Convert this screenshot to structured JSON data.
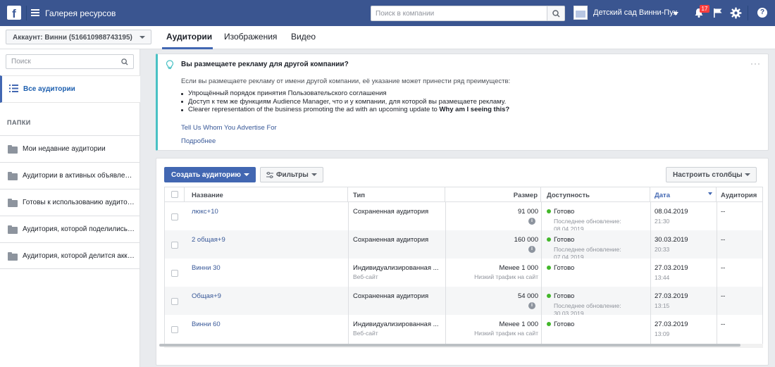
{
  "topbar": {
    "logo": "f",
    "menu_icon": "hamburger-icon",
    "title": "Галерея ресурсов",
    "search_placeholder": "Поиск в компании",
    "business_name": "Детский сад Винни-Пух",
    "notifications_count": "17",
    "help": "?"
  },
  "account": {
    "label": "Аккаунт: Винни (516610988743195)"
  },
  "tabs": [
    "Аудитории",
    "Изображения",
    "Видео"
  ],
  "sidebar": {
    "search_placeholder": "Поиск",
    "all_audiences": "Все аудитории",
    "folders_header": "ПАПКИ",
    "folders": [
      "Мои недавние аудитории",
      "Аудитории в активных объявлениях",
      "Готовы к использованию аудитории",
      "Аудитория, которой поделились с вами",
      "Аудитория, которой делится аккаунт"
    ]
  },
  "info": {
    "title": "Вы размещаете рекламу для другой компании?",
    "intro": "Если вы размещаете рекламу от имени другой компании, её указание может принести ряд преимуществ:",
    "bullets": [
      "Упрощённый порядок принятия Пользовательского соглашения",
      "Доступ к тем же функциям Audience Manager, что и у компании, для которой вы размещаете рекламу."
    ],
    "bullet3_text": "Clearer representation of the business promoting the ad with an upcoming update to ",
    "bullet3_bold": "Why am I seeing this?",
    "link1": "Tell Us Whom You Advertise For",
    "link2": "Подробнее",
    "more": "···"
  },
  "toolbar": {
    "create": "Создать аудиторию",
    "filters": "Фильтры",
    "columns": "Настроить столбцы"
  },
  "table": {
    "headers": {
      "name": "Название",
      "type": "Тип",
      "size": "Размер",
      "availability": "Доступность",
      "date": "Дата",
      "audience": "Аудитория"
    },
    "rows": [
      {
        "name": "люкс+10",
        "type": "Сохраненная аудитория",
        "type_sub": "",
        "size": "91 000",
        "size_sub": "",
        "status": "Готово",
        "status_sub": "Последнее обновление: 08.04.2019",
        "date": "08.04.2019",
        "time": "21:30",
        "audience": "--"
      },
      {
        "name": "2 общая+9",
        "type": "Сохраненная аудитория",
        "type_sub": "",
        "size": "160 000",
        "size_sub": "",
        "status": "Готово",
        "status_sub": "Последнее обновление: 07.04.2019",
        "date": "30.03.2019",
        "time": "20:33",
        "audience": "--"
      },
      {
        "name": "Винни 30",
        "type": "Индивидуализированная ...",
        "type_sub": "Веб-сайт",
        "size": "Менее 1 000",
        "size_sub": "Низкий трафик на сайт",
        "status": "Готово",
        "status_sub": "",
        "date": "27.03.2019",
        "time": "13:44",
        "audience": "--"
      },
      {
        "name": "Общая+9",
        "type": "Сохраненная аудитория",
        "type_sub": "",
        "size": "54 000",
        "size_sub": "",
        "status": "Готово",
        "status_sub": "Последнее обновление: 30.03.2019",
        "date": "27.03.2019",
        "time": "13:15",
        "audience": "--"
      },
      {
        "name": "Винни 60",
        "type": "Индивидуализированная ...",
        "type_sub": "Веб-сайт",
        "size": "Менее 1 000",
        "size_sub": "Низкий трафик на сайт",
        "status": "Готово",
        "status_sub": "",
        "date": "27.03.2019",
        "time": "13:09",
        "audience": "--"
      }
    ]
  },
  "colors": {
    "topbar": "#3a5590",
    "primary": "#4267b2",
    "link": "#385898",
    "tip_accent": "#49c1c4",
    "ready_green": "#42b72a",
    "badge_red": "#fa3e3e"
  }
}
